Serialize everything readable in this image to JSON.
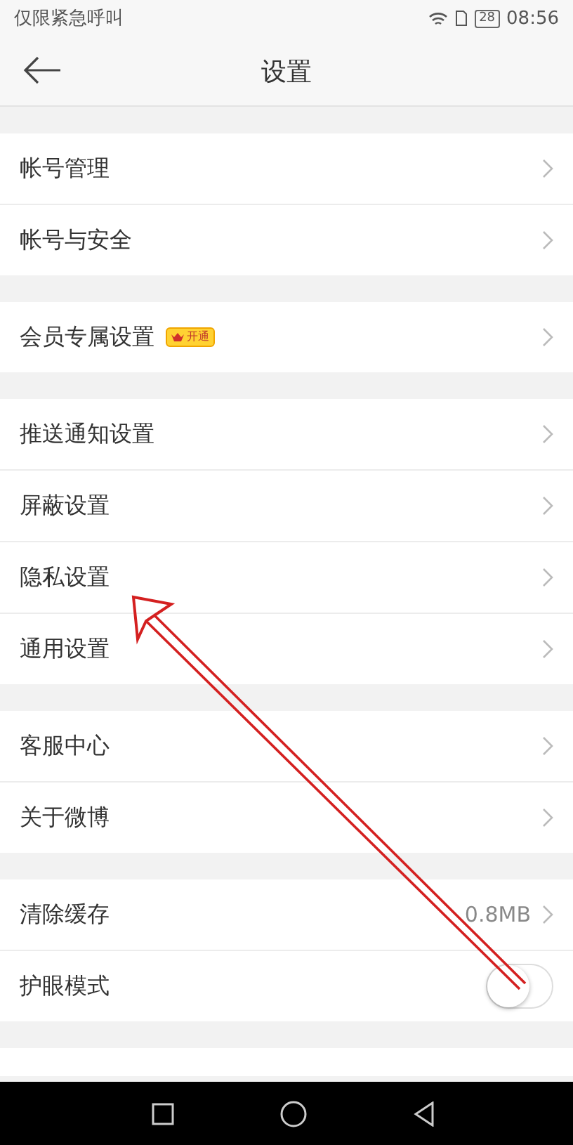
{
  "status_bar": {
    "carrier": "仅限紧急呼叫",
    "battery": "28",
    "time": "08:56"
  },
  "header": {
    "title": "设置"
  },
  "sections": [
    {
      "items": [
        {
          "kind": "link",
          "label": "帐号管理"
        },
        {
          "kind": "link",
          "label": "帐号与安全"
        }
      ]
    },
    {
      "items": [
        {
          "kind": "link",
          "label": "会员专属设置",
          "badge": "开通"
        }
      ]
    },
    {
      "items": [
        {
          "kind": "link",
          "label": "推送通知设置"
        },
        {
          "kind": "link",
          "label": "屏蔽设置"
        },
        {
          "kind": "link",
          "label": "隐私设置"
        },
        {
          "kind": "link",
          "label": "通用设置"
        }
      ]
    },
    {
      "items": [
        {
          "kind": "link",
          "label": "客服中心"
        },
        {
          "kind": "link",
          "label": "关于微博"
        }
      ]
    },
    {
      "items": [
        {
          "kind": "link",
          "label": "清除缓存",
          "value": "0.8MB"
        },
        {
          "kind": "toggle",
          "label": "护眼模式",
          "on": false
        }
      ]
    }
  ]
}
